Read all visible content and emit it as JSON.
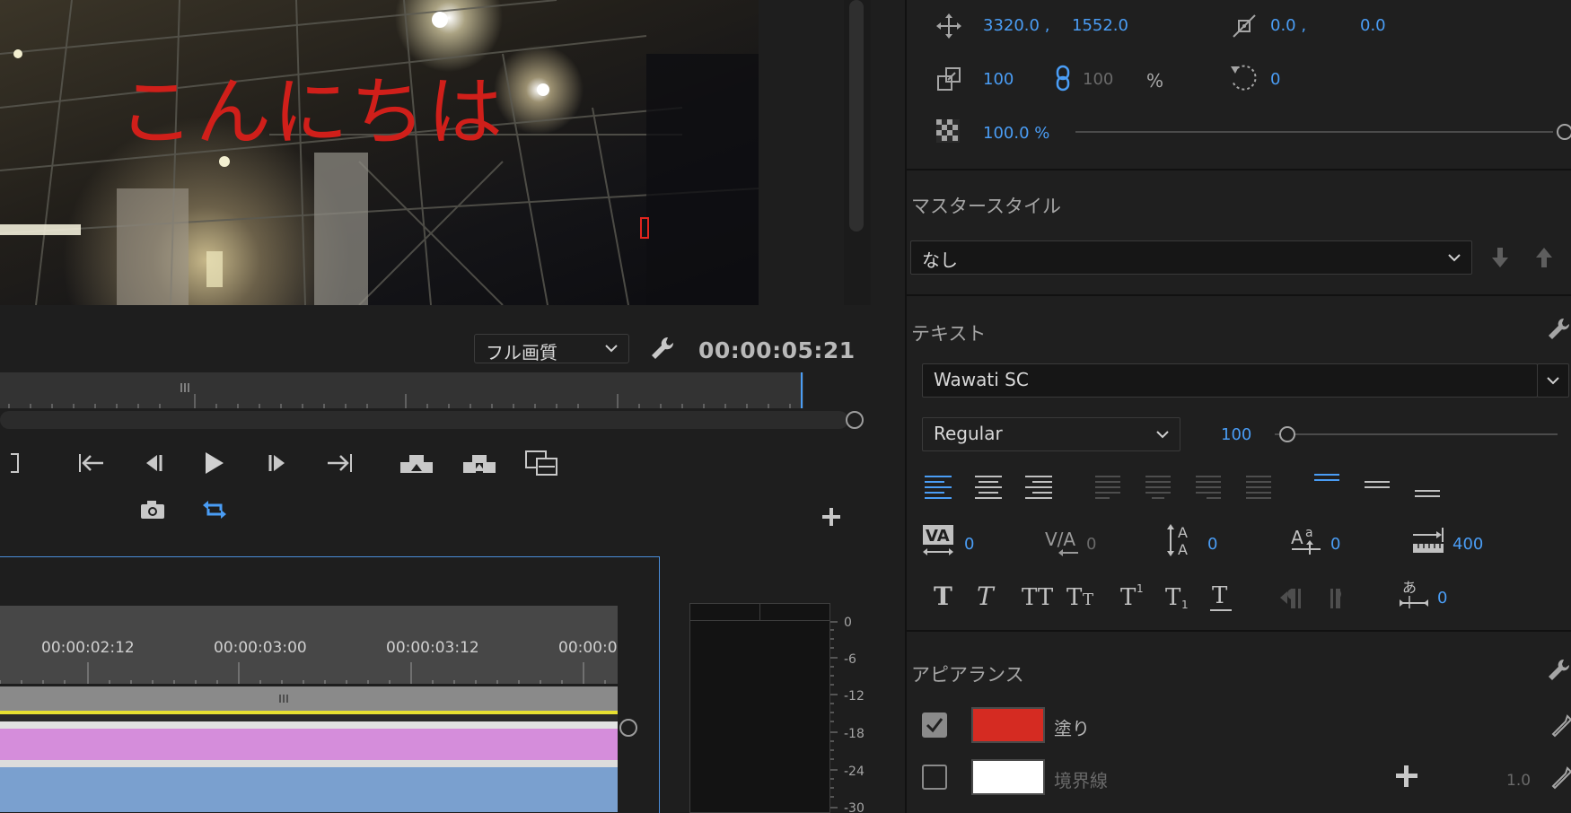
{
  "viewer": {
    "caption_text": "こんにちは",
    "quality_label": "フル画質",
    "timecode": "00:00:05:21"
  },
  "timeline": {
    "times": [
      "00:00:02:12",
      "00:00:03:00",
      "00:00:03:12",
      "00:00:0"
    ],
    "meter_scale": [
      "0",
      "-6",
      "-12",
      "-18",
      "-24",
      "-30"
    ]
  },
  "transform": {
    "position_x": "3320.0 ,",
    "position_y": "1552.0",
    "anchor_x": "0.0 ,",
    "anchor_y": "0.0",
    "scale_w": "100",
    "scale_h": "100",
    "scale_unit": "%",
    "rotation": "0",
    "opacity": "100.0 %"
  },
  "master_style": {
    "title": "マスタースタイル",
    "value": "なし"
  },
  "text": {
    "title": "テキスト",
    "font": "Wawati SC",
    "style": "Regular",
    "size": "100",
    "kerning": "0",
    "tracking": "0",
    "leading": "0",
    "baseline": "0",
    "tab_width": "400",
    "tsume": "0"
  },
  "appearance": {
    "title": "アピアランス",
    "fill_label": "塗り",
    "fill_color": "#d52b22",
    "stroke_label": "境界線",
    "stroke_color": "#ffffff",
    "stroke_width": "1.0"
  }
}
